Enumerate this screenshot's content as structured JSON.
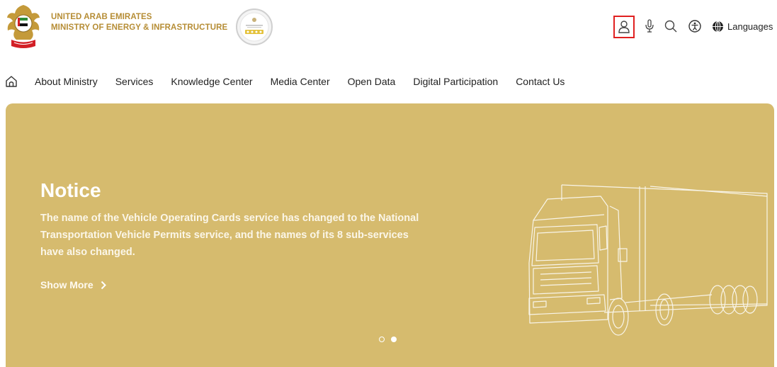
{
  "header": {
    "org_line1": "UNITED ARAB EMIRATES",
    "org_line2": "MINISTRY OF ENERGY & INFRASTRUCTURE",
    "emblem_icon": "uae-emblem-icon",
    "award_icon": "star-rating-badge-icon",
    "tools": {
      "profile_icon": "user-icon",
      "mic_icon": "microphone-icon",
      "search_icon": "search-icon",
      "accessibility_icon": "accessibility-icon",
      "languages_icon": "globe-icon",
      "languages_label": "Languages"
    }
  },
  "nav": {
    "home_icon": "home-icon",
    "items": [
      {
        "label": "About Ministry"
      },
      {
        "label": "Services"
      },
      {
        "label": "Knowledge Center"
      },
      {
        "label": "Media Center"
      },
      {
        "label": "Open Data"
      },
      {
        "label": "Digital Participation"
      },
      {
        "label": "Contact Us"
      }
    ]
  },
  "hero": {
    "title": "Notice",
    "description": "The name of the Vehicle Operating Cards service has changed to the National Transportation Vehicle Permits service, and the names of its 8 sub-services have also changed.",
    "show_more_label": "Show More",
    "slide_count": 2,
    "active_slide": 2,
    "background_color": "#d6bb6e",
    "illustration_icon": "truck-icon"
  },
  "colors": {
    "brand_gold": "#b68d35",
    "highlight_red": "#e02020"
  }
}
